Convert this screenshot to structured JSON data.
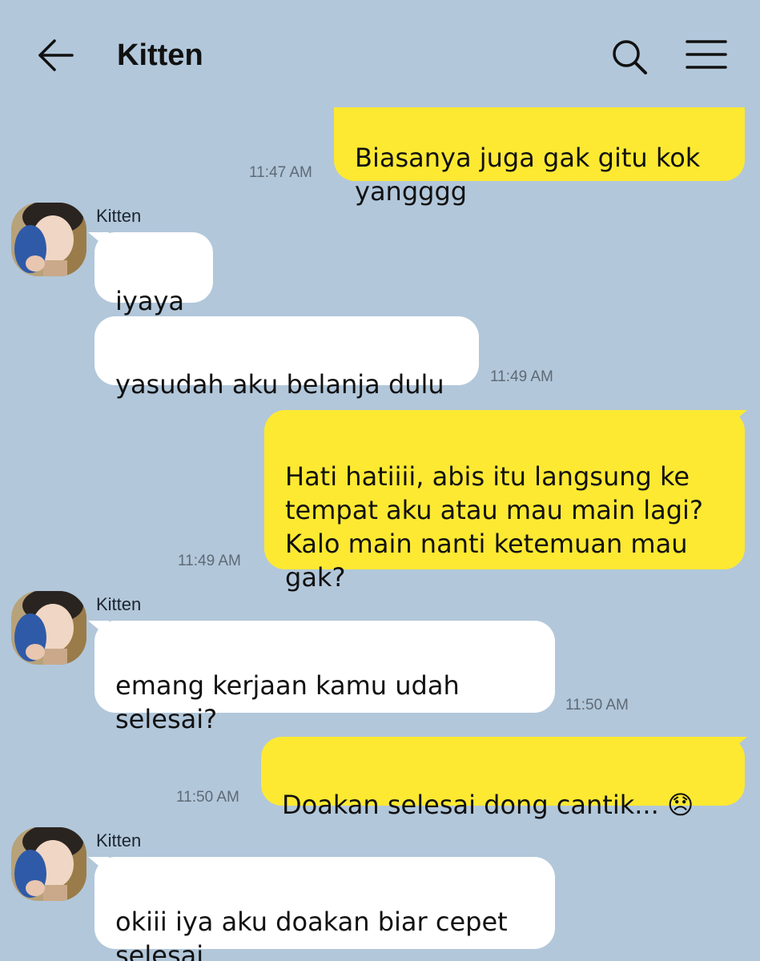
{
  "header": {
    "title": "Kitten",
    "back_icon": "arrow-left-icon",
    "search_icon": "search-icon",
    "menu_icon": "menu-icon"
  },
  "colors": {
    "background": "#b2c7da",
    "my_bubble": "#fde932",
    "their_bubble": "#ffffff"
  },
  "messages": [
    {
      "id": "m1",
      "from": "me",
      "text": "Biasanya juga gak gitu kok\nyangggg",
      "time": "11:47 AM"
    },
    {
      "id": "m2",
      "from": "Kitten",
      "sender": "Kitten",
      "text": "iyaya",
      "time": ""
    },
    {
      "id": "m3",
      "from": "Kitten",
      "text": "yasudah aku belanja dulu",
      "time": "11:49 AM"
    },
    {
      "id": "m4",
      "from": "me",
      "text": "Hati hatiiii, abis itu langsung ke\ntempat aku atau mau main lagi?\nKalo main nanti ketemuan mau\ngak?",
      "time": "11:49 AM"
    },
    {
      "id": "m5",
      "from": "Kitten",
      "sender": "Kitten",
      "text": "emang kerjaan kamu udah\nselesai?",
      "time": "11:50 AM"
    },
    {
      "id": "m6",
      "from": "me",
      "text": "Doakan selesai dong cantik... 😞",
      "time": "11:50 AM"
    },
    {
      "id": "m7",
      "from": "Kitten",
      "sender": "Kitten",
      "text": "okiii iya aku doakan biar cepet\nselesai",
      "time": ""
    }
  ]
}
